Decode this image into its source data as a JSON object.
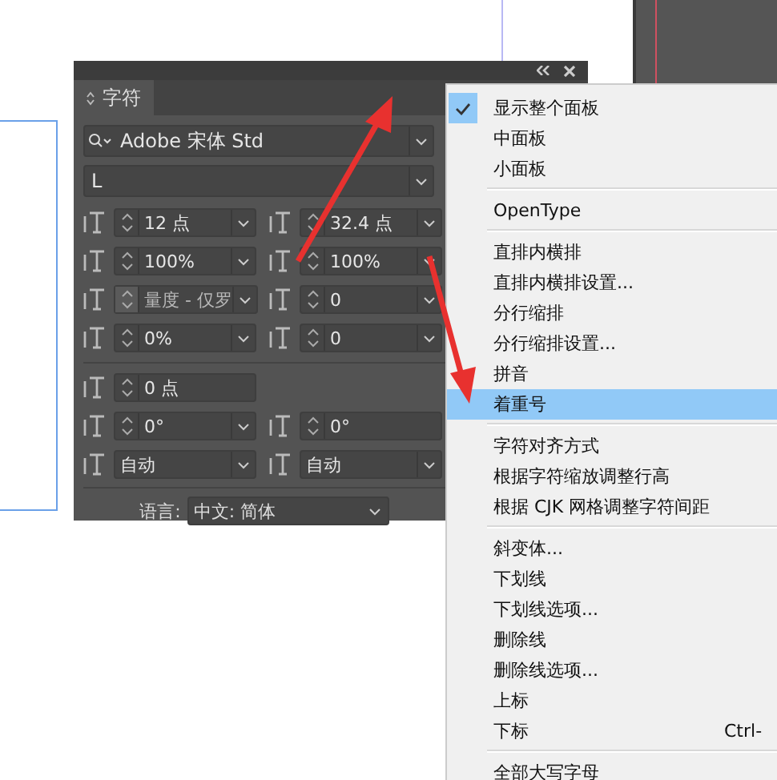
{
  "panel": {
    "tab": {
      "label": "字符",
      "selected": true
    },
    "font_family": "Adobe 宋体 Std",
    "font_style": "L",
    "fields": [
      {
        "value": "12 点",
        "spinner": true,
        "dropdown": true,
        "disabled": false
      },
      {
        "value": "32.4 点",
        "spinner": true,
        "dropdown": true,
        "disabled": false
      },
      {
        "value": "100%",
        "spinner": true,
        "dropdown": true,
        "disabled": false
      },
      {
        "value": "100%",
        "spinner": true,
        "dropdown": true,
        "disabled": false
      },
      {
        "value": "量度 - 仅罗",
        "spinner": true,
        "dropdown": true,
        "disabled": true
      },
      {
        "value": "0",
        "spinner": true,
        "dropdown": true,
        "disabled": false
      },
      {
        "value": "0%",
        "spinner": true,
        "dropdown": true,
        "disabled": false
      },
      {
        "value": "0",
        "spinner": true,
        "dropdown": true,
        "disabled": false
      }
    ],
    "fields_2": [
      {
        "value": "0 点",
        "spinner": true,
        "dropdown": false,
        "disabled": false
      },
      {
        "kind": "blank"
      },
      {
        "value": "0°",
        "spinner": true,
        "dropdown": true,
        "disabled": false
      },
      {
        "value": "0°",
        "spinner": true,
        "dropdown": false,
        "disabled": false
      },
      {
        "value": "自动",
        "spinner": false,
        "dropdown": true,
        "disabled": false
      },
      {
        "value": "自动",
        "spinner": false,
        "dropdown": true,
        "disabled": false
      }
    ],
    "language": {
      "label": "语言:",
      "value": "中文: 简体"
    }
  },
  "menu": {
    "groups": [
      {
        "items": [
          {
            "label": "显示整个面板",
            "checked": true,
            "selected": false
          },
          {
            "label": "中面板",
            "checked": false,
            "selected": false
          },
          {
            "label": "小面板",
            "checked": false,
            "selected": false
          }
        ]
      },
      {
        "items": [
          {
            "label": "OpenType",
            "checked": false,
            "selected": false
          }
        ]
      },
      {
        "items": [
          {
            "label": "直排内横排",
            "checked": false,
            "selected": false
          },
          {
            "label": "直排内横排设置...",
            "checked": false,
            "selected": false
          },
          {
            "label": "分行缩排",
            "checked": false,
            "selected": false
          },
          {
            "label": "分行缩排设置...",
            "checked": false,
            "selected": false
          },
          {
            "label": "拼音",
            "checked": false,
            "selected": false
          },
          {
            "label": "着重号",
            "checked": false,
            "selected": true
          }
        ]
      },
      {
        "items": [
          {
            "label": "字符对齐方式",
            "checked": false,
            "selected": false
          },
          {
            "label": "根据字符缩放调整行高",
            "checked": false,
            "selected": false
          },
          {
            "label": "根据 CJK 网格调整字符间距",
            "checked": false,
            "selected": false
          }
        ]
      },
      {
        "items": [
          {
            "label": "斜变体...",
            "checked": false,
            "selected": false
          },
          {
            "label": "下划线",
            "checked": false,
            "selected": false
          },
          {
            "label": "下划线选项...",
            "checked": false,
            "selected": false
          },
          {
            "label": "删除线",
            "checked": false,
            "selected": false
          },
          {
            "label": "删除线选项...",
            "checked": false,
            "selected": false
          },
          {
            "label": "上标",
            "checked": false,
            "selected": false
          },
          {
            "label": "下标",
            "checked": false,
            "selected": false,
            "shortcut": "Ctrl-"
          }
        ]
      },
      {
        "items": [
          {
            "label": "全部大写字母",
            "checked": false,
            "selected": false
          }
        ]
      }
    ]
  }
}
